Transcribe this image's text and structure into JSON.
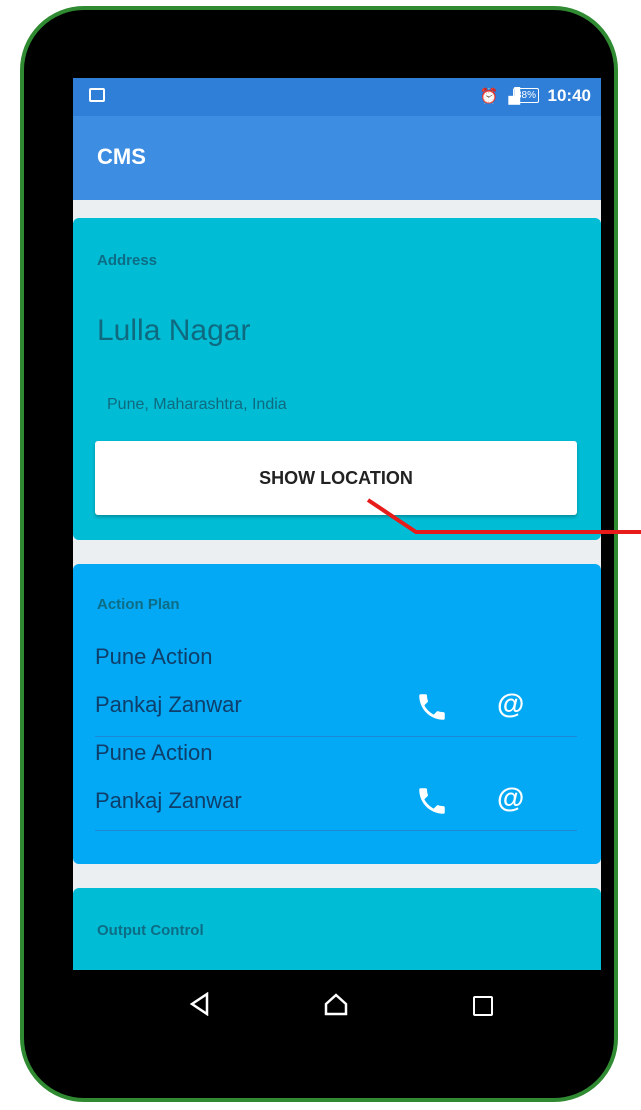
{
  "status_bar": {
    "time": "10:40",
    "battery": "38%"
  },
  "app_bar": {
    "title": "CMS"
  },
  "address_card": {
    "label": "Address",
    "place": "Lulla Nagar",
    "region": "Pune, Maharashtra, India",
    "button_label": "SHOW LOCATION"
  },
  "action_card": {
    "label": "Action Plan",
    "rows": [
      {
        "group": "Pune Action",
        "name": "Pankaj Zanwar",
        "email_symbol": "@"
      },
      {
        "group": "Pune Action",
        "name": "Pankaj Zanwar",
        "email_symbol": "@"
      }
    ]
  },
  "output_card": {
    "label": "Output Control"
  }
}
